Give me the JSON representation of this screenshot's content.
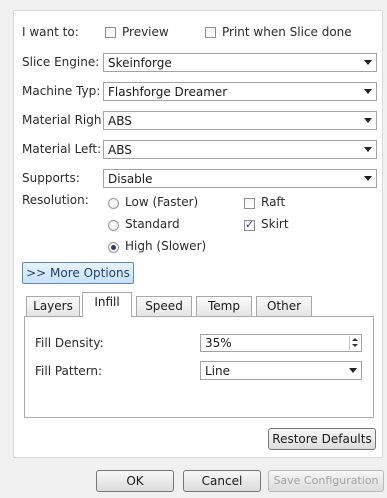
{
  "options": {
    "i_want_to_label": "I want to:",
    "preview_label": "Preview",
    "preview_checked": false,
    "print_when_done_label": "Print when Slice done",
    "print_when_done_checked": false
  },
  "fields": [
    {
      "label": "Slice Engine:",
      "value": "Skeinforge"
    },
    {
      "label": "Machine Typ:",
      "value": "Flashforge Dreamer"
    },
    {
      "label": "Material Right:",
      "value": "ABS"
    },
    {
      "label": "Material Left:",
      "value": "ABS"
    },
    {
      "label": "Supports:",
      "value": "Disable"
    }
  ],
  "resolution": {
    "label": "Resolution:",
    "options": [
      "Low (Faster)",
      "Standard",
      "High (Slower)"
    ],
    "selected": "High (Slower)"
  },
  "extras": {
    "raft_label": "Raft",
    "raft_checked": false,
    "skirt_label": "Skirt",
    "skirt_checked": true
  },
  "more_options_label": ">> More Options",
  "tabs": [
    {
      "label": "Layers",
      "active": false
    },
    {
      "label": "Infill",
      "active": true
    },
    {
      "label": "Speed",
      "active": false
    },
    {
      "label": "Temp",
      "active": false
    },
    {
      "label": "Other",
      "active": false
    }
  ],
  "infill": {
    "fill_density_label": "Fill Density:",
    "fill_density_value": "35%",
    "fill_pattern_label": "Fill Pattern:",
    "fill_pattern_value": "Line"
  },
  "buttons": {
    "restore_defaults": "Restore Defaults",
    "ok": "OK",
    "cancel": "Cancel",
    "save_configuration": "Save Configuration"
  },
  "colors": {
    "accent_border": "#5b88c4",
    "accent_fill": "#c7e1fb",
    "panel_bg": "#ffffff",
    "window_bg": "#f0f0f0"
  }
}
